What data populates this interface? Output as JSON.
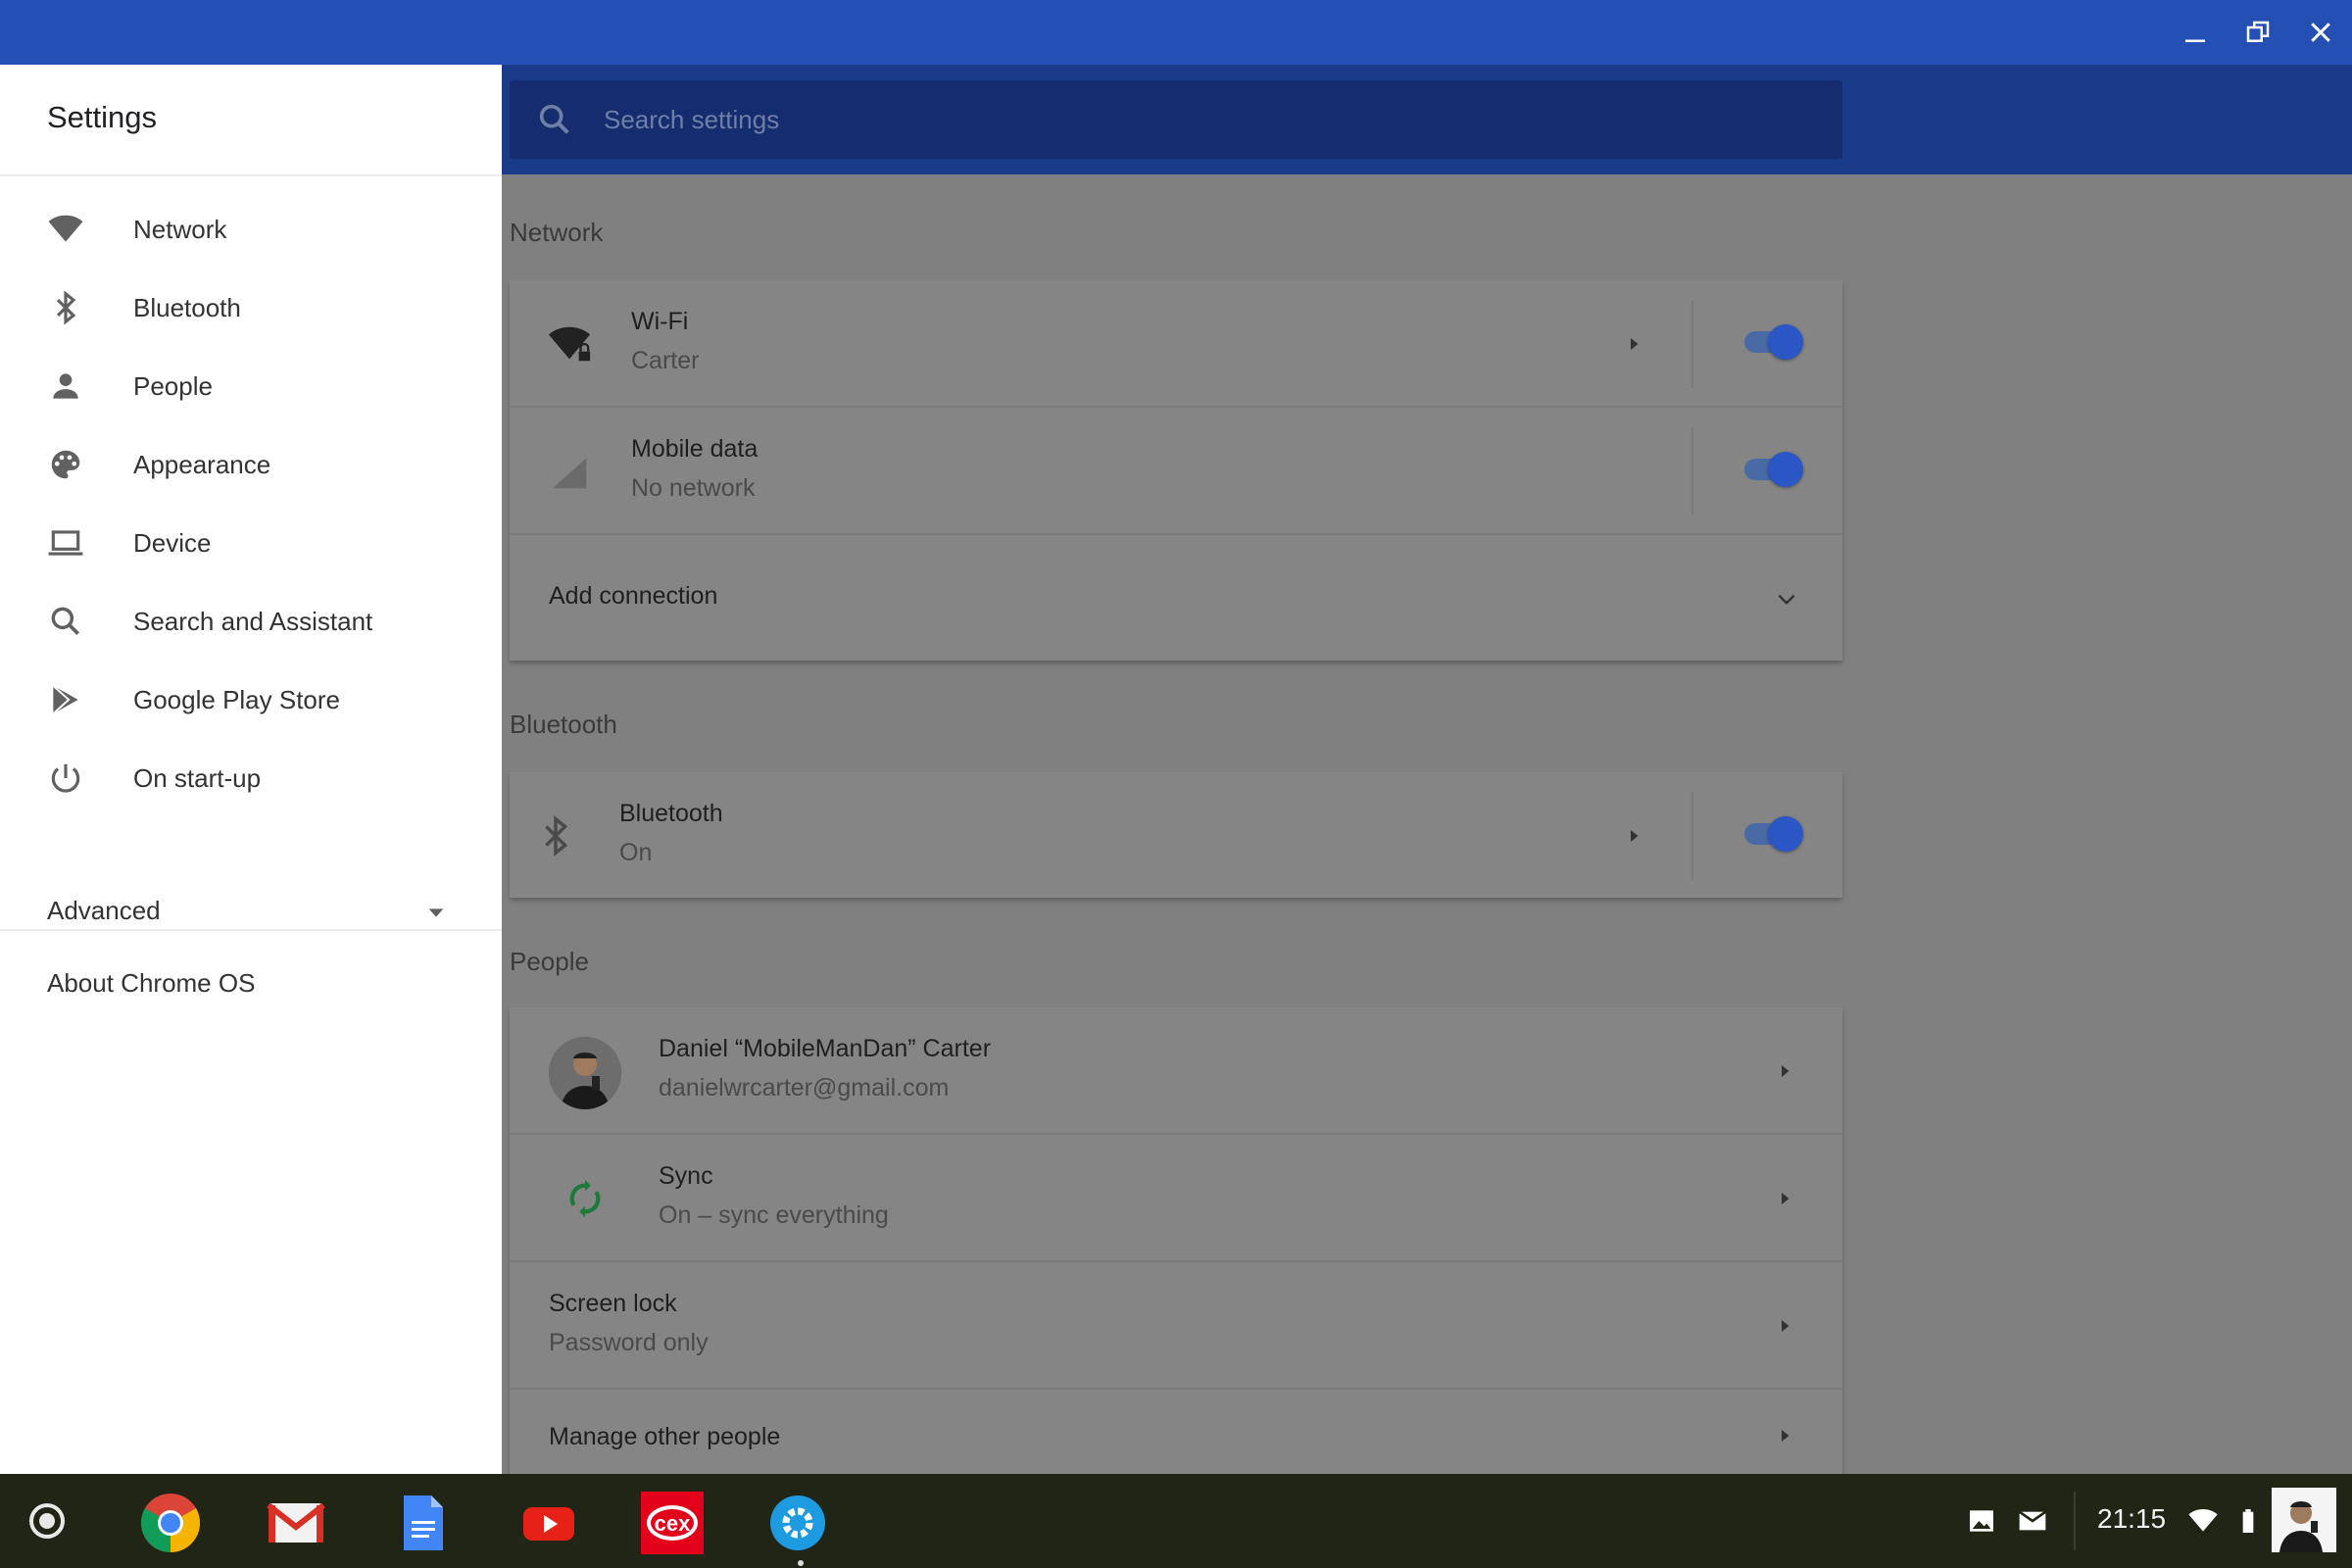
{
  "window": {
    "minimize_icon": "minimize-icon",
    "restore_icon": "restore-icon",
    "close_icon": "close-icon"
  },
  "search": {
    "placeholder": "Search settings",
    "icon": "search-icon"
  },
  "sidebar": {
    "title": "Settings",
    "items": [
      {
        "label": "Network",
        "icon": "wifi-icon"
      },
      {
        "label": "Bluetooth",
        "icon": "bluetooth-icon"
      },
      {
        "label": "People",
        "icon": "person-icon"
      },
      {
        "label": "Appearance",
        "icon": "palette-icon"
      },
      {
        "label": "Device",
        "icon": "laptop-icon"
      },
      {
        "label": "Search and Assistant",
        "icon": "search-icon"
      },
      {
        "label": "Google Play Store",
        "icon": "play-store-icon"
      },
      {
        "label": "On start-up",
        "icon": "power-icon"
      }
    ],
    "advanced": "Advanced",
    "about": "About Chrome OS"
  },
  "network": {
    "section_title": "Network",
    "wifi": {
      "title": "Wi-Fi",
      "subtitle": "Carter",
      "enabled": true
    },
    "mobile": {
      "title": "Mobile data",
      "subtitle": "No network",
      "enabled": true
    },
    "add_connection": "Add connection"
  },
  "bluetooth": {
    "section_title": "Bluetooth",
    "item": {
      "title": "Bluetooth",
      "subtitle": "On",
      "enabled": true
    }
  },
  "people": {
    "section_title": "People",
    "account": {
      "name": "Daniel “MobileManDan” Carter",
      "email": "danielwrcarter@gmail.com"
    },
    "sync": {
      "title": "Sync",
      "subtitle": "On – sync everything"
    },
    "screen_lock": {
      "title": "Screen lock",
      "subtitle": "Password only"
    },
    "manage": "Manage other people"
  },
  "shelf": {
    "apps": [
      "chrome-icon",
      "gmail-icon",
      "docs-icon",
      "youtube-icon",
      "cex-icon",
      "settings-icon"
    ],
    "cex_label": "cex",
    "clock": "21:15"
  },
  "colors": {
    "titlebar": "#2350b2",
    "toggle_on": "#2a57c5",
    "sync_green": "#1e7a3a"
  }
}
